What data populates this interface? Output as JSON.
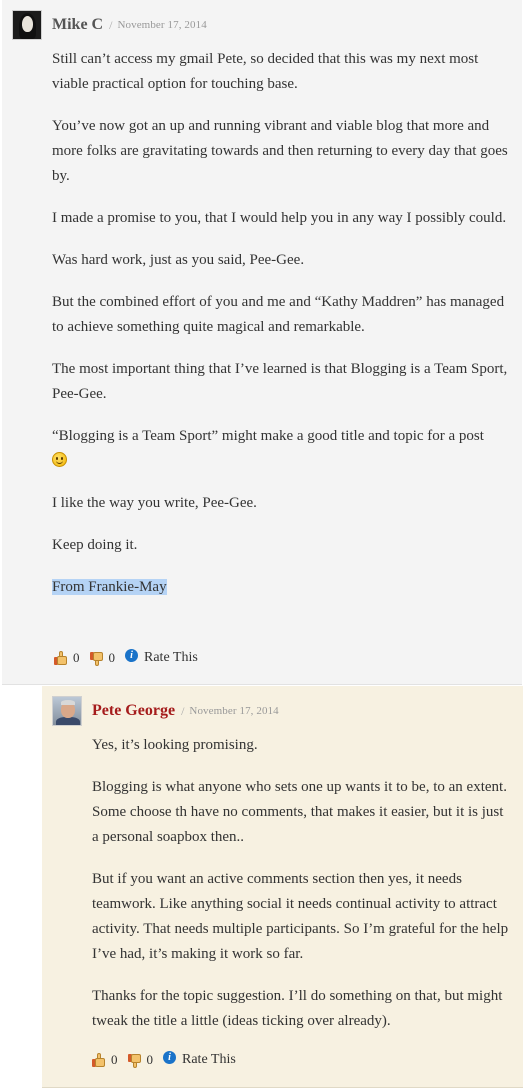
{
  "comments": [
    {
      "author": "Mike C",
      "separator": "/",
      "date": "November 17, 2014",
      "paragraphs": [
        "Still can’t access my gmail Pete, so decided that this was my next most viable practical option for touching base.",
        "You’ve now got an up and running vibrant and viable blog that more and more folks are gravitating towards and then returning to every day that goes by.",
        "I made a promise to you, that I would help you in any way I possibly could.",
        "Was hard work, just as you said, Pee-Gee.",
        "But the combined effort of you and me and “Kathy Maddren” has managed to achieve something quite magical and remarkable.",
        "The most important thing that I’ve learned is that Blogging is a Team Sport, Pee-Gee.",
        "“Blogging is a Team Sport” might make a good title and topic for a post",
        "I like the way you write, Pee-Gee.",
        "Keep doing it.",
        "From Frankie-May"
      ],
      "rating": {
        "up_count": "0",
        "down_count": "0",
        "rate_label": "Rate This"
      }
    },
    {
      "author": "Pete George",
      "separator": "/",
      "date": "November 17, 2014",
      "paragraphs": [
        "Yes, it’s looking promising.",
        "Blogging is what anyone who sets one up wants it to be, to an extent. Some choose th have no comments, that makes it easier, but it is just a personal soapbox then..",
        "But if you want an active comments section then yes, it needs teamwork. Like anything social it needs continual activity to attract activity. That needs multiple participants. So I’m grateful for the help I’ve had, it’s making it work so far.",
        "Thanks for the topic suggestion. I’ll do something on that, but might tweak the title a little (ideas ticking over already)."
      ],
      "rating": {
        "up_count": "0",
        "down_count": "0",
        "rate_label": "Rate This"
      }
    }
  ],
  "icons": {
    "thumbs_up": "thumbs-up-icon",
    "thumbs_down": "thumbs-down-icon",
    "info": "info-icon",
    "smiley": "smiley-icon"
  },
  "colors": {
    "comment_bg": "#f4f4f4",
    "reply_bg": "#f7f1e1",
    "author_link": "#a51c1c",
    "selection_highlight": "#b5d3f5",
    "info_blue": "#1a73c9"
  }
}
